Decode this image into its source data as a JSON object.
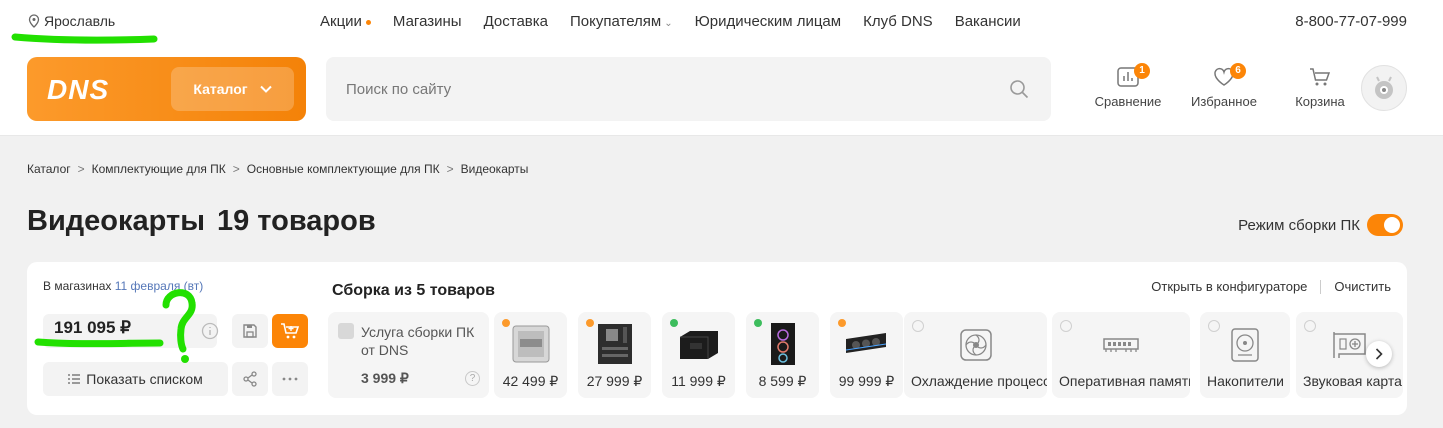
{
  "topbar": {
    "city": "Ярославль",
    "nav": [
      {
        "label": "Акции",
        "dot": true
      },
      {
        "label": "Магазины"
      },
      {
        "label": "Доставка"
      },
      {
        "label": "Покупателям",
        "dropdown": true
      },
      {
        "label": "Юридическим лицам"
      },
      {
        "label": "Клуб DNS"
      },
      {
        "label": "Вакансии"
      }
    ],
    "phone": "8-800-77-07-999"
  },
  "header": {
    "logo": "DNS",
    "catalog_label": "Каталог",
    "search_placeholder": "Поиск по сайту",
    "icons": [
      {
        "label": "Сравнение",
        "icon": "compare-icon",
        "badge": "1"
      },
      {
        "label": "Избранное",
        "icon": "heart-icon",
        "badge": "6"
      },
      {
        "label": "Корзина",
        "icon": "cart-icon",
        "badge": ""
      }
    ]
  },
  "breadcrumbs": [
    "Каталог",
    "Комплектующие для ПК",
    "Основные комплектующие для ПК",
    "Видеокарты"
  ],
  "page": {
    "title": "Видеокарты",
    "count": "19 товаров",
    "build_mode_label": "Режим сборки ПК",
    "build_mode_on": true
  },
  "assembly": {
    "stock_prefix": "В магазинах",
    "stock_date": "11 февраля (вт)",
    "total_price": "191 095 ₽",
    "show_list_label": "Показать списком",
    "title": "Сборка из 5 товаров",
    "open_configurator": "Открыть в конфигураторе",
    "clear": "Очистить",
    "service": {
      "label": "Услуга сборки ПК от DNS",
      "price": "3 999 ₽",
      "help": "?"
    },
    "items": [
      {
        "price": "42 499 ₽",
        "status": "orange",
        "icon": "cpu-icon"
      },
      {
        "price": "27 999 ₽",
        "status": "orange",
        "icon": "motherboard-icon"
      },
      {
        "price": "11 999 ₽",
        "status": "green",
        "icon": "power-supply-icon"
      },
      {
        "price": "8 599 ₽",
        "status": "green",
        "icon": "pc-case-icon"
      },
      {
        "price": "99 999 ₽",
        "status": "orange",
        "icon": "gpu-icon"
      }
    ],
    "empty_slots": [
      {
        "label": "Охлаждение процессора",
        "icon": "fan-icon"
      },
      {
        "label": "Оперативная память",
        "icon": "ram-icon"
      },
      {
        "label": "Накопители",
        "icon": "drive-icon"
      },
      {
        "label": "Звуковая карта",
        "icon": "sound-card-icon"
      }
    ]
  },
  "annotations": {
    "question_mark": "?"
  },
  "colors": {
    "accent": "#fc8507",
    "green_status": "#3dbd5d",
    "link": "#5577b8",
    "scribble": "#22e000"
  }
}
